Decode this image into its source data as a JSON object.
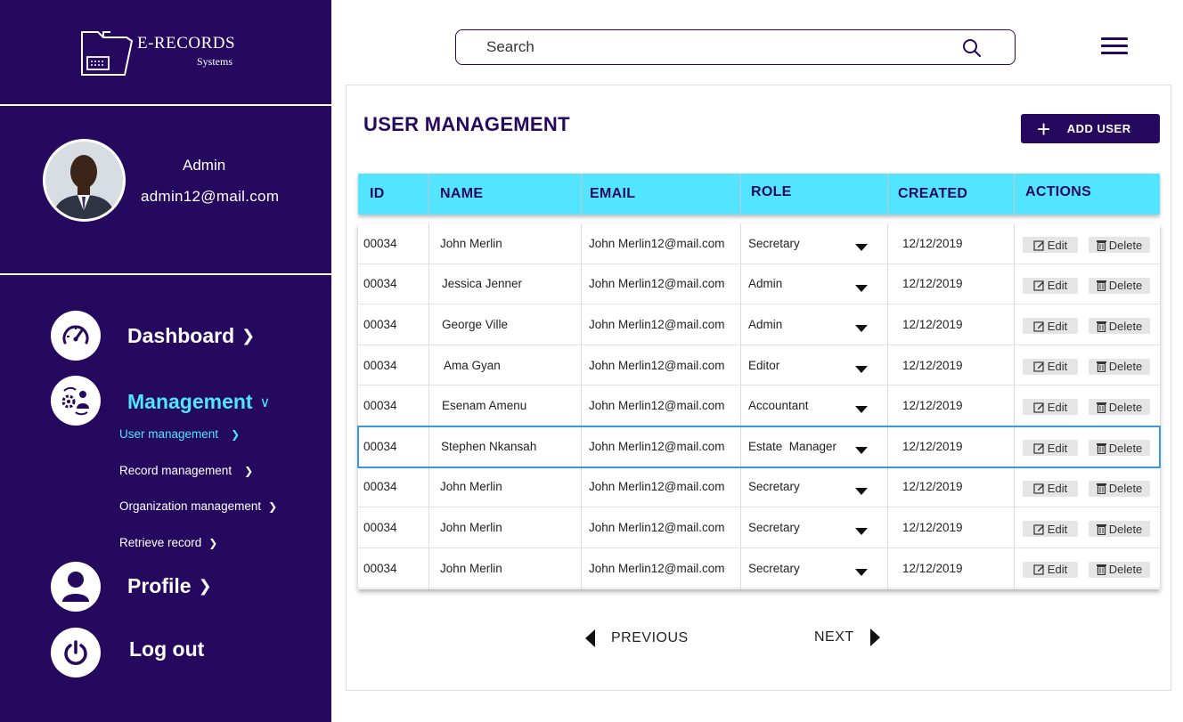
{
  "brand": {
    "title": "E-RECORDS",
    "subtitle": "Systems"
  },
  "user": {
    "name": "Admin",
    "email": "admin12@mail.com"
  },
  "nav": {
    "dashboard": "Dashboard",
    "management": "Management",
    "profile": "Profile",
    "logout": "Log out",
    "sub_items": [
      "User management",
      "Record management",
      "Organization management",
      "Retrieve record"
    ]
  },
  "search": {
    "placeholder": "Search"
  },
  "page": {
    "title": "USER MANAGEMENT",
    "add_button": "ADD USER"
  },
  "table": {
    "headers": [
      "ID",
      "NAME",
      "EMAIL",
      "ROLE",
      "CREATED",
      "ACTIONS"
    ],
    "edit_label": "Edit",
    "delete_label": "Delete",
    "rows": [
      {
        "id": "00034",
        "name": "John Merlin",
        "email": "John Merlin12@mail.com",
        "role": "Secretary",
        "created": "12/12/2019"
      },
      {
        "id": "00034",
        "name": "Jessica Jenner",
        "email": "John Merlin12@mail.com",
        "role": "Admin",
        "created": "12/12/2019"
      },
      {
        "id": "00034",
        "name": "George Ville",
        "email": "John Merlin12@mail.com",
        "role": "Admin",
        "created": "12/12/2019"
      },
      {
        "id": "00034",
        "name": "Ama Gyan",
        "email": "John Merlin12@mail.com",
        "role": "Editor",
        "created": "12/12/2019"
      },
      {
        "id": "00034",
        "name": "Esenam Amenu",
        "email": "John Merlin12@mail.com",
        "role": "Accountant",
        "created": "12/12/2019"
      },
      {
        "id": "00034",
        "name": "Stephen Nkansah",
        "email": "John Merlin12@mail.com",
        "role": "Estate  Manager",
        "created": "12/12/2019"
      },
      {
        "id": "00034",
        "name": "John Merlin",
        "email": "John Merlin12@mail.com",
        "role": "Secretary",
        "created": "12/12/2019"
      },
      {
        "id": "00034",
        "name": "John Merlin",
        "email": "John Merlin12@mail.com",
        "role": "Secretary",
        "created": "12/12/2019"
      },
      {
        "id": "00034",
        "name": "John Merlin",
        "email": "John Merlin12@mail.com",
        "role": "Secretary",
        "created": "12/12/2019"
      }
    ]
  },
  "pagination": {
    "previous": "PREVIOUS",
    "next": "NEXT"
  },
  "colors": {
    "sidebar": "#24095f",
    "accent": "#53e5ff",
    "active_link": "#4fe4ff",
    "highlight_border": "#3a9ad9"
  }
}
